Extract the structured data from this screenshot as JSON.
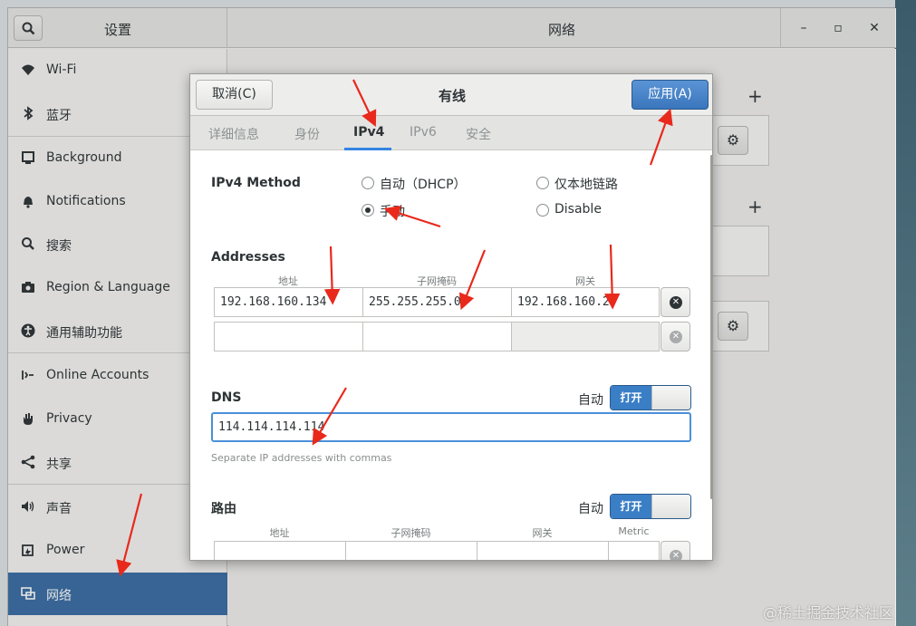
{
  "window": {
    "sidebar_title": "设置",
    "main_title": "网络",
    "controls": {
      "minimize": "–",
      "maximize": "▫",
      "close": "✕"
    }
  },
  "sidebar": {
    "items": [
      {
        "label": "Wi-Fi",
        "icon": "wifi-icon"
      },
      {
        "label": "蓝牙",
        "icon": "bluetooth-icon"
      },
      {
        "label": "Background",
        "icon": "background-icon"
      },
      {
        "label": "Notifications",
        "icon": "bell-icon"
      },
      {
        "label": "搜索",
        "icon": "search-icon"
      },
      {
        "label": "Region & Language",
        "icon": "camera-icon"
      },
      {
        "label": "通用辅助功能",
        "icon": "accessibility-icon"
      },
      {
        "label": "Online Accounts",
        "icon": "online-accounts-icon"
      },
      {
        "label": "Privacy",
        "icon": "hand-icon"
      },
      {
        "label": "共享",
        "icon": "share-icon"
      },
      {
        "label": "声音",
        "icon": "speaker-icon"
      },
      {
        "label": "Power",
        "icon": "power-icon"
      },
      {
        "label": "网络",
        "icon": "network-icon",
        "active": true
      }
    ]
  },
  "dialog": {
    "title": "有线",
    "cancel": "取消(C)",
    "apply": "应用(A)",
    "tabs": [
      "详细信息",
      "身份",
      "IPv4",
      "IPv6",
      "安全"
    ],
    "active_tab": "IPv4",
    "ipv4_method": {
      "label": "IPv4 Method",
      "options": [
        "自动（DHCP）",
        "仅本地链路",
        "手动",
        "Disable"
      ],
      "selected": "手动"
    },
    "addresses": {
      "label": "Addresses",
      "headers": [
        "地址",
        "子网掩码",
        "网关"
      ],
      "rows": [
        [
          "192.168.160.134",
          "255.255.255.0",
          "192.168.160.2"
        ],
        [
          "",
          "",
          ""
        ]
      ]
    },
    "dns": {
      "label": "DNS",
      "auto_label": "自动",
      "switch_label": "打开",
      "value": "114.114.114.114",
      "hint": "Separate IP addresses with commas"
    },
    "routes": {
      "label": "路由",
      "auto_label": "自动",
      "switch_label": "打开",
      "headers": [
        "地址",
        "子网掩码",
        "网关",
        "Metric"
      ]
    }
  },
  "watermark": "@稀土掘金技术社区",
  "colors": {
    "accent": "#3584e4",
    "selected": "#3a6ea5",
    "annotation": "#e8291c"
  }
}
